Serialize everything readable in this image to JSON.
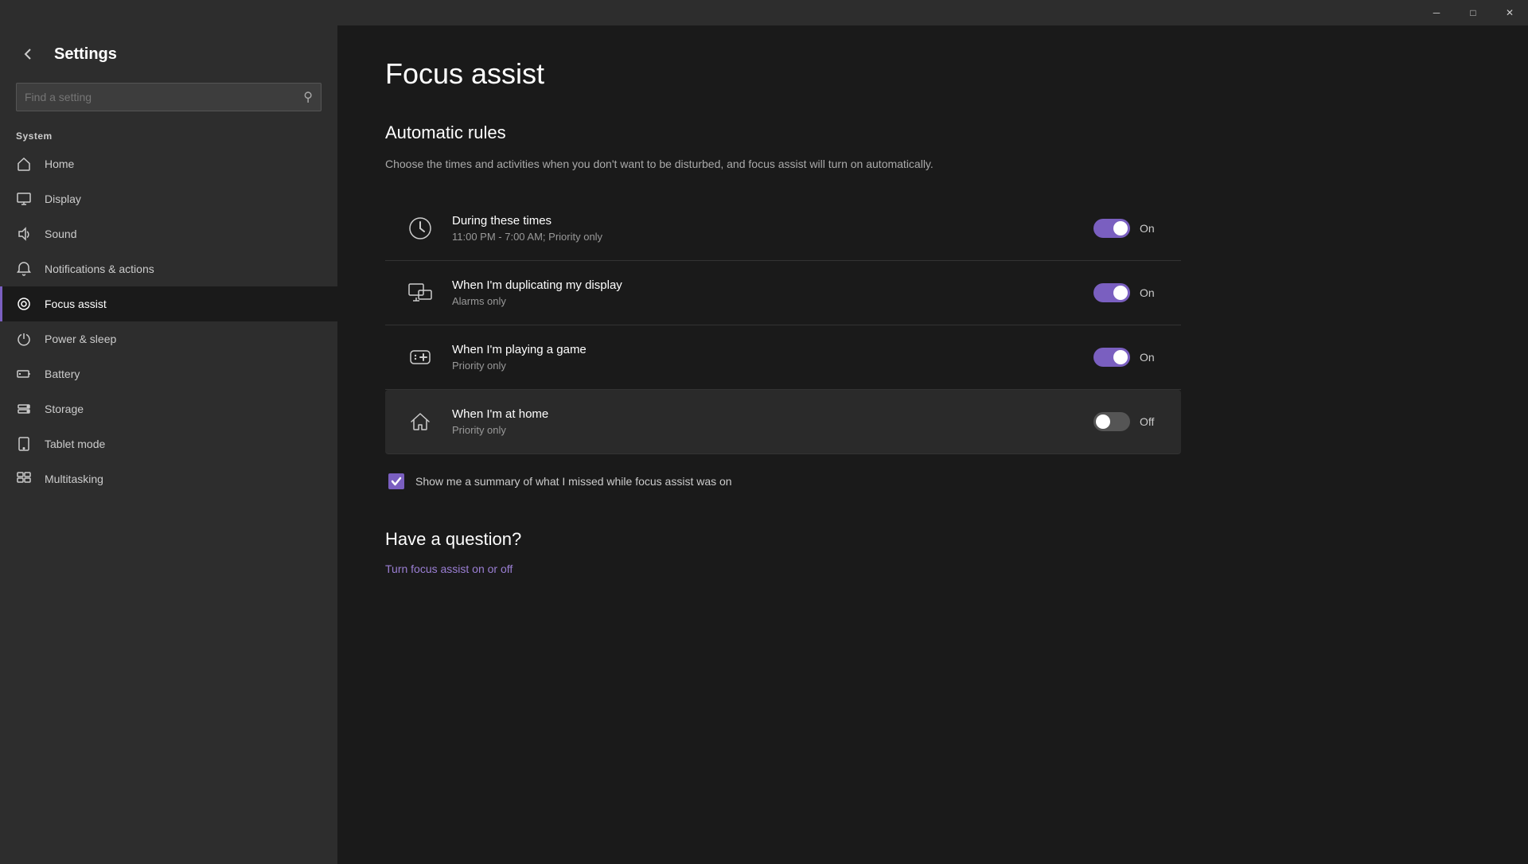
{
  "titlebar": {
    "minimize_label": "─",
    "maximize_label": "□",
    "close_label": "✕"
  },
  "sidebar": {
    "back_icon": "←",
    "app_title": "Settings",
    "search_placeholder": "Find a setting",
    "search_icon": "🔍",
    "system_label": "System",
    "nav_items": [
      {
        "id": "home",
        "label": "Home",
        "icon": "home"
      },
      {
        "id": "display",
        "label": "Display",
        "icon": "display"
      },
      {
        "id": "sound",
        "label": "Sound",
        "icon": "sound"
      },
      {
        "id": "notifications",
        "label": "Notifications & actions",
        "icon": "notifications"
      },
      {
        "id": "focus",
        "label": "Focus assist",
        "icon": "focus",
        "active": true
      },
      {
        "id": "power",
        "label": "Power & sleep",
        "icon": "power"
      },
      {
        "id": "battery",
        "label": "Battery",
        "icon": "battery"
      },
      {
        "id": "storage",
        "label": "Storage",
        "icon": "storage"
      },
      {
        "id": "tablet",
        "label": "Tablet mode",
        "icon": "tablet"
      },
      {
        "id": "multitasking",
        "label": "Multitasking",
        "icon": "multitasking"
      }
    ]
  },
  "content": {
    "page_title": "Focus assist",
    "section_heading": "Automatic rules",
    "section_description": "Choose the times and activities when you don't want to be disturbed, and focus assist will turn on automatically.",
    "rules": [
      {
        "id": "during-times",
        "title": "During these times",
        "subtitle": "11:00 PM - 7:00 AM; Priority only",
        "icon": "clock",
        "state": "on",
        "state_label": "On"
      },
      {
        "id": "duplicating-display",
        "title": "When I'm duplicating my display",
        "subtitle": "Alarms only",
        "icon": "display",
        "state": "on",
        "state_label": "On"
      },
      {
        "id": "playing-game",
        "title": "When I'm playing a game",
        "subtitle": "Priority only",
        "icon": "game",
        "state": "on",
        "state_label": "On"
      },
      {
        "id": "at-home",
        "title": "When I'm at home",
        "subtitle": "Priority only",
        "icon": "home",
        "state": "off",
        "state_label": "Off",
        "highlighted": true
      }
    ],
    "summary_checkbox_checked": true,
    "summary_text": "Show me a summary of what I missed while focus assist was on",
    "question_title": "Have a question?",
    "help_link": "Turn focus assist on or off"
  }
}
